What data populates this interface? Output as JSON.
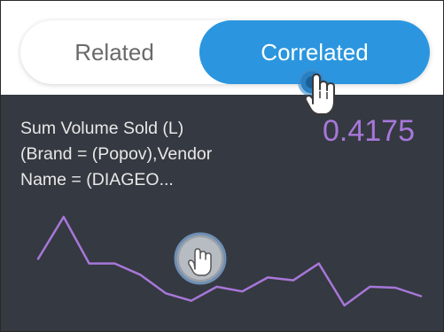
{
  "toggle": {
    "related_label": "Related",
    "correlated_label": "Correlated",
    "active": "Correlated"
  },
  "card": {
    "metric_lines": [
      "Sum Volume Sold (L)",
      "(Brand = (Popov),Vendor",
      "Name = (DIAGEO..."
    ],
    "value": "0.4175"
  },
  "colors": {
    "active_tab": "#2b96df",
    "panel_bg": "#353941",
    "accent": "#a777d9"
  },
  "sparkline_values": [
    0.45,
    0.9,
    0.4,
    0.4,
    0.28,
    0.08,
    0.0,
    0.15,
    0.1,
    0.25,
    0.22,
    0.4,
    -0.05,
    0.15,
    0.14,
    0.05
  ],
  "cursors": [
    "hand-pointer-icon",
    "hand-pointer-icon"
  ]
}
